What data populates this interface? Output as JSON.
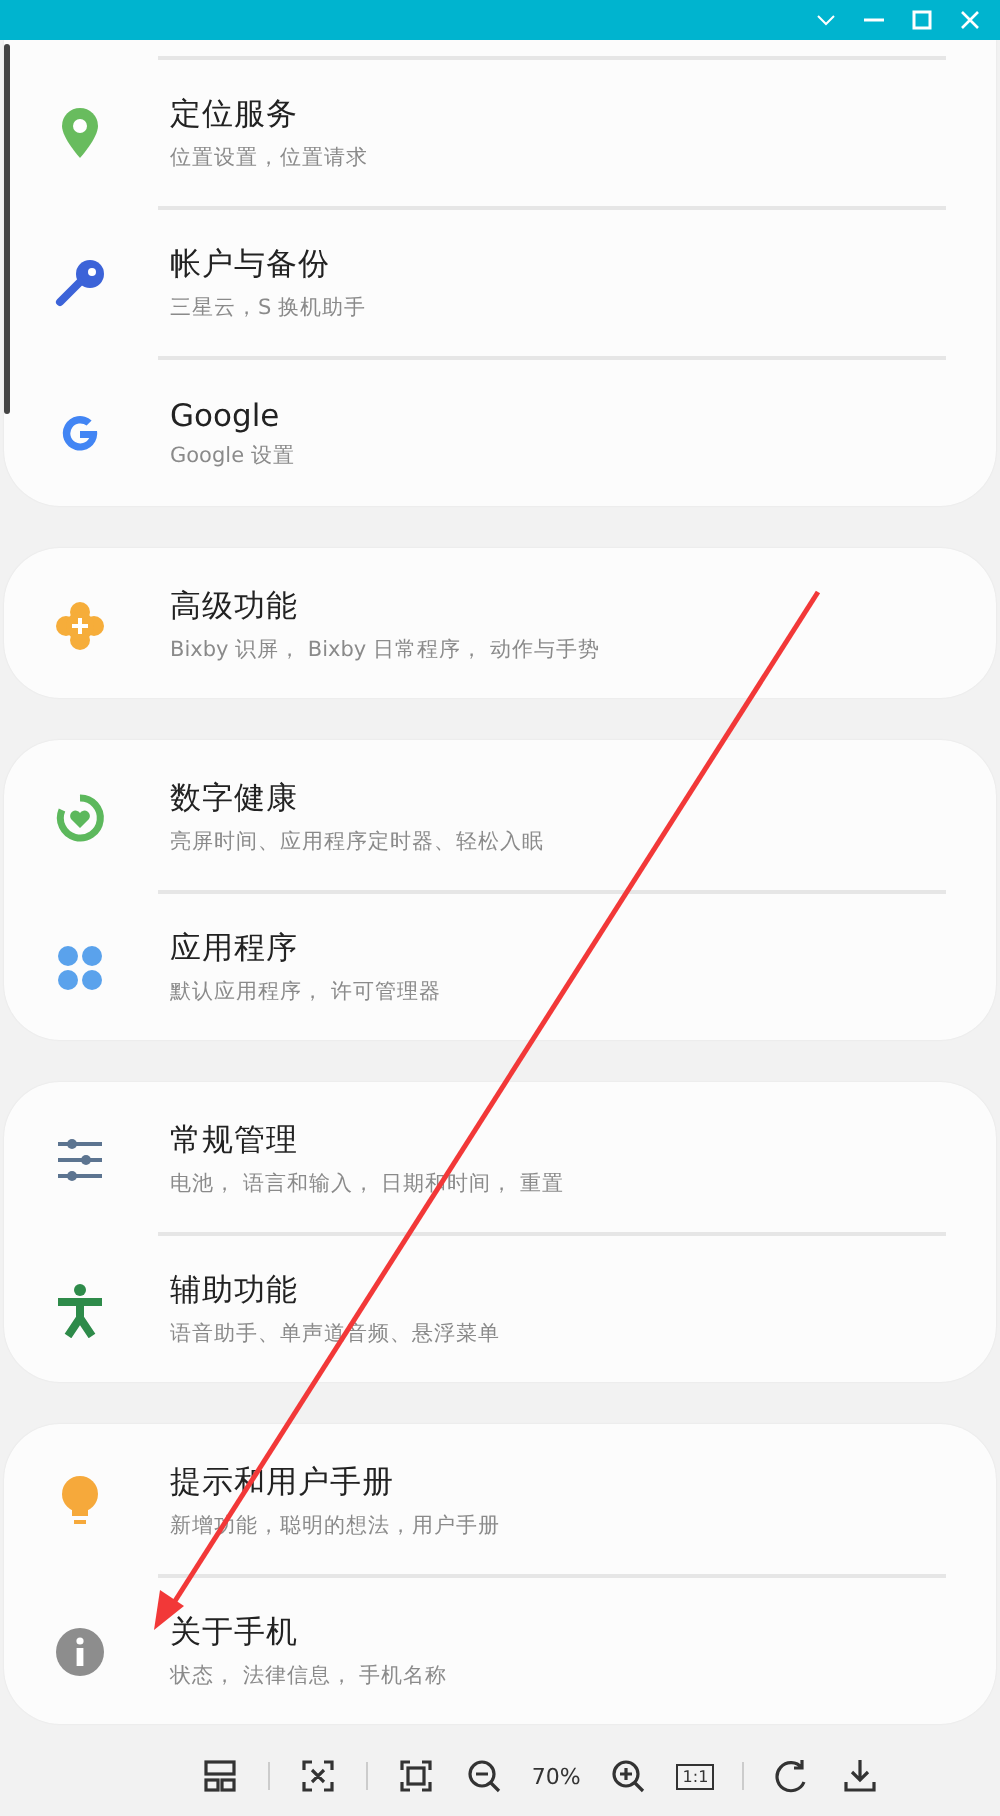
{
  "groups": [
    {
      "items": [
        {
          "title": "定位服务",
          "subtitle": "位置设置，位置请求"
        },
        {
          "title": "帐户与备份",
          "subtitle": "三星云，S 换机助手"
        },
        {
          "title": "Google",
          "subtitle": "Google 设置"
        }
      ]
    },
    {
      "items": [
        {
          "title": "高级功能",
          "subtitle": "Bixby 识屏， Bixby 日常程序， 动作与手势"
        }
      ]
    },
    {
      "items": [
        {
          "title": "数字健康",
          "subtitle": "亮屏时间、应用程序定时器、轻松入眠"
        },
        {
          "title": "应用程序",
          "subtitle": "默认应用程序， 许可管理器"
        }
      ]
    },
    {
      "items": [
        {
          "title": "常规管理",
          "subtitle": "电池， 语言和输入， 日期和时间， 重置"
        },
        {
          "title": "辅助功能",
          "subtitle": "语音助手、单声道音频、悬浮菜单"
        }
      ]
    },
    {
      "items": [
        {
          "title": "提示和用户手册",
          "subtitle": "新增功能，聪明的想法，用户手册"
        },
        {
          "title": "关于手机",
          "subtitle": "状态， 法律信息， 手机名称"
        }
      ]
    }
  ],
  "toolbar": {
    "zoom": "70%",
    "actual_size": "1:1"
  }
}
